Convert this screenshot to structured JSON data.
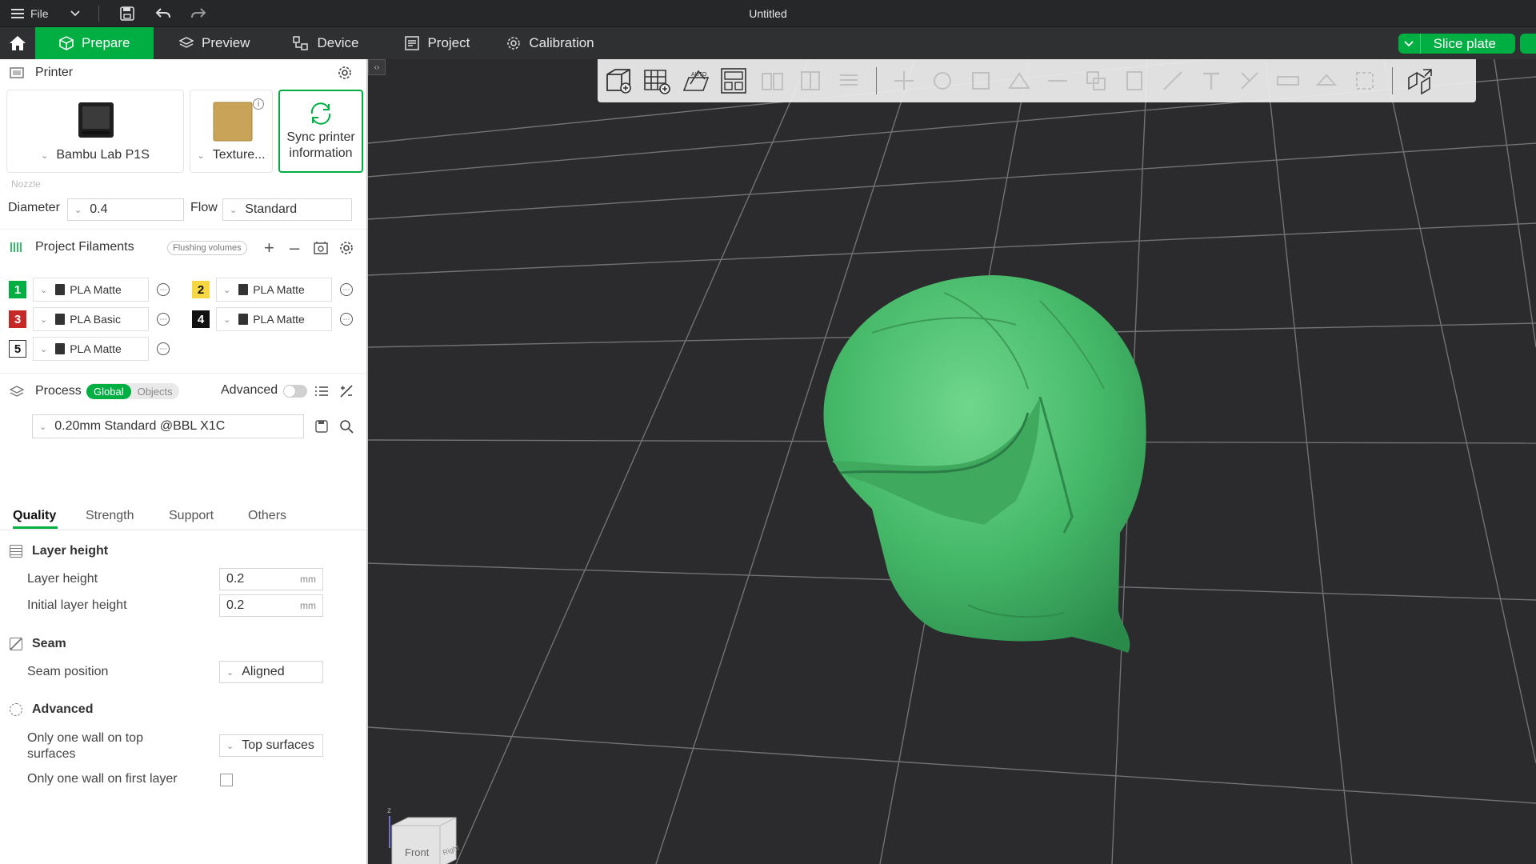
{
  "titlebar": {
    "menu_label": "File",
    "title": "Untitled"
  },
  "tabs": [
    {
      "label": "Prepare",
      "active": true
    },
    {
      "label": "Preview"
    },
    {
      "label": "Device"
    },
    {
      "label": "Project"
    },
    {
      "label": "Calibration"
    }
  ],
  "slice_button": "Slice plate",
  "printer": {
    "section_title": "Printer",
    "printer_name": "Bambu Lab P1S",
    "plate_name": "Texture...",
    "sync_label_line1": "Sync printer",
    "sync_label_line2": "information",
    "nozzle_label": "Nozzle",
    "diameter_label": "Diameter",
    "diameter_value": "0.4",
    "flow_label": "Flow",
    "flow_value": "Standard"
  },
  "filaments": {
    "section_title": "Project Filaments",
    "flushing_label": "Flushing volumes",
    "items": [
      {
        "num": "1",
        "name": "PLA Matte",
        "color": "#00ae42"
      },
      {
        "num": "2",
        "name": "PLA Matte",
        "color": "#f5d742"
      },
      {
        "num": "3",
        "name": "PLA Basic",
        "color": "#c62828"
      },
      {
        "num": "4",
        "name": "PLA Matte",
        "color": "#111111"
      },
      {
        "num": "5",
        "name": "PLA Matte",
        "color": "#ffffff"
      }
    ]
  },
  "process": {
    "section_title": "Process",
    "global_label": "Global",
    "objects_label": "Objects",
    "advanced_label": "Advanced",
    "profile": "0.20mm Standard @BBL X1C",
    "tabs": [
      "Quality",
      "Strength",
      "Support",
      "Others"
    ],
    "groups": {
      "layer_height": {
        "title": "Layer height",
        "layer_height_label": "Layer height",
        "layer_height_value": "0.2",
        "initial_label": "Initial layer height",
        "initial_value": "0.2",
        "unit": "mm"
      },
      "seam": {
        "title": "Seam",
        "position_label": "Seam position",
        "position_value": "Aligned"
      },
      "advanced": {
        "title": "Advanced",
        "one_wall_top_label_line1": "Only one wall on top",
        "one_wall_top_label_line2": "surfaces",
        "one_wall_top_value": "Top surfaces",
        "one_wall_first_label": "Only one wall on first layer"
      }
    }
  },
  "viewport": {
    "model_color": "#3fae5c",
    "view_cube_front": "Front",
    "view_cube_right": "Right",
    "axis_z": "z"
  }
}
